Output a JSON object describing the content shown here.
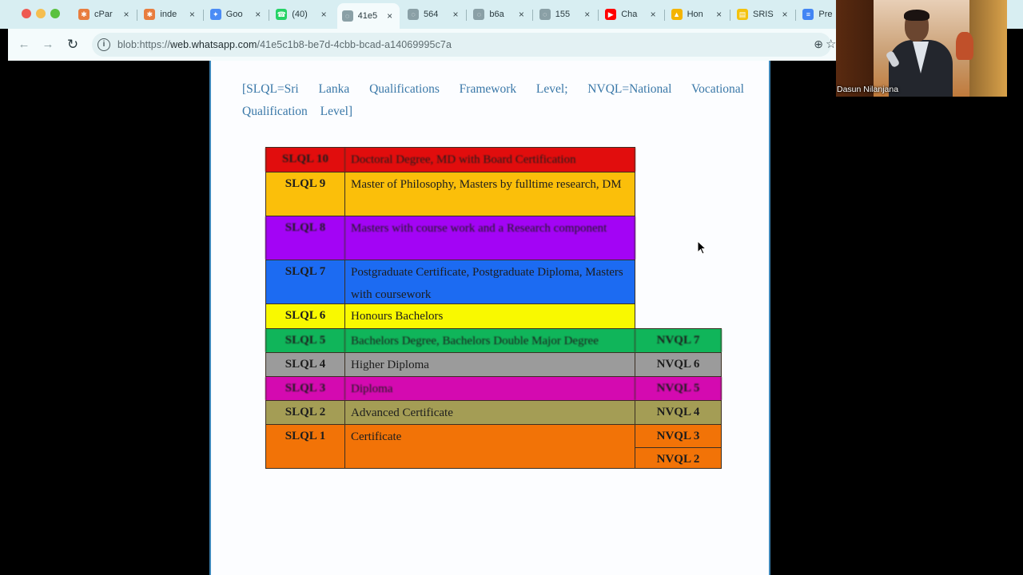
{
  "browser": {
    "tabs": [
      {
        "label": "cPar",
        "color": "#e87d3e",
        "glyph": "✱"
      },
      {
        "label": "inde",
        "color": "#e87d3e",
        "glyph": "✱"
      },
      {
        "label": "Goo",
        "color": "#4b8cf5",
        "glyph": "✦"
      },
      {
        "label": "(40)",
        "color": "#25d366",
        "glyph": "☎"
      },
      {
        "label": "41e5",
        "color": "#8aa0a6",
        "glyph": "◌"
      },
      {
        "label": "564",
        "color": "#8aa0a6",
        "glyph": "◌"
      },
      {
        "label": "b6a",
        "color": "#8aa0a6",
        "glyph": "◌"
      },
      {
        "label": "155",
        "color": "#8aa0a6",
        "glyph": "◌"
      },
      {
        "label": "Cha",
        "color": "#ff0000",
        "glyph": "▶"
      },
      {
        "label": "Hon",
        "color": "#f4b400",
        "glyph": "▲"
      },
      {
        "label": "SRIS",
        "color": "#f4c20d",
        "glyph": "▤"
      },
      {
        "label": "Pre",
        "color": "#4285f4",
        "glyph": "≡"
      }
    ],
    "url_prefix": "blob:https://",
    "url_host": "web.whatsapp.com",
    "url_path": "/41e5c1b8-be7d-4cbb-bcad-a14069995c7a",
    "icons": {
      "back": "←",
      "forward": "→",
      "reload": "↻",
      "info": "i",
      "zoom": "⊕",
      "star": "☆",
      "close": "×"
    }
  },
  "video": {
    "participant_name": "Dasun Nilanjana"
  },
  "document": {
    "abbreviation_note": "[SLQL=Sri Lanka Qualifications Framework Level; NVQL=National Vocational Qualification Level]",
    "table": {
      "rows": [
        {
          "code": "SLQL 10",
          "desc": "Doctoral Degree, MD with Board Certification",
          "nvql": "",
          "color": "#e10d0d",
          "blur": true,
          "lines": 1
        },
        {
          "code": "SLQL 9",
          "desc": "Master of Philosophy, Masters by fulltime research, DM",
          "nvql": "",
          "color": "#fbbf0a",
          "blur": false,
          "lines": 2
        },
        {
          "code": "SLQL 8",
          "desc": "Masters with course work and a Research component",
          "nvql": "",
          "color": "#a304f5",
          "blur": true,
          "lines": 2
        },
        {
          "code": "SLQL 7",
          "desc": "Postgraduate Certificate, Postgraduate Diploma, Masters with coursework",
          "nvql": "",
          "color": "#1c6bf2",
          "blur": false,
          "lines": 2
        },
        {
          "code": "SLQL 6",
          "desc": "Honours Bachelors",
          "nvql": "",
          "color": "#f9f900",
          "blur": false,
          "lines": 1
        },
        {
          "code": "SLQL 5",
          "desc": "Bachelors Degree, Bachelors Double Major Degree",
          "nvql": "NVQL 7",
          "color": "#10b55a",
          "blur": true,
          "lines": 1
        },
        {
          "code": "SLQL 4",
          "desc": "Higher Diploma",
          "nvql": "NVQL 6",
          "color": "#9b9b9b",
          "blur": false,
          "lines": 1
        },
        {
          "code": "SLQL 3",
          "desc": "Diploma",
          "nvql": "NVQL 5",
          "color": "#d40ab0",
          "blur": true,
          "lines": 1
        },
        {
          "code": "SLQL 2",
          "desc": "Advanced Certificate",
          "nvql": "NVQL 4",
          "color": "#a49d55",
          "blur": false,
          "lines": 1
        },
        {
          "code": "SLQL 1",
          "desc": "Certificate",
          "nvql": "NVQL 3",
          "nvql2": "NVQL 2",
          "color": "#f27307",
          "blur": false,
          "lines": 2
        }
      ]
    }
  }
}
